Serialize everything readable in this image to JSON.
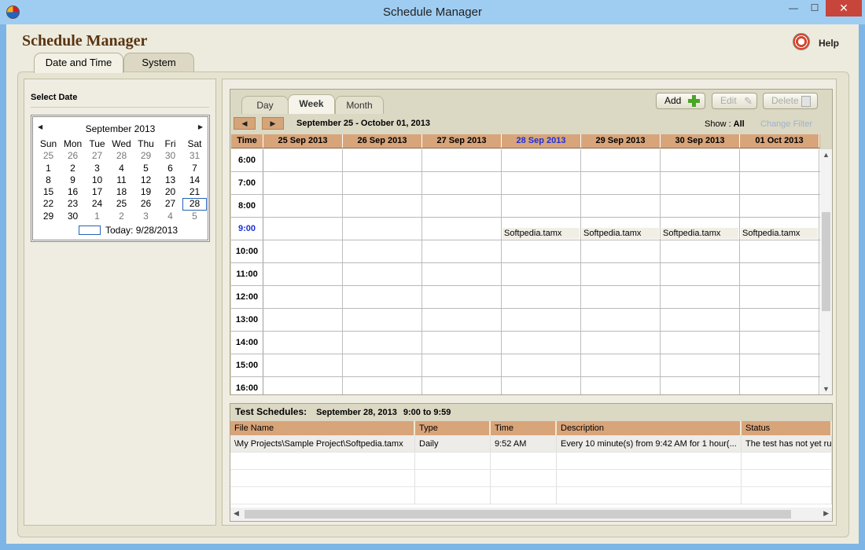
{
  "window": {
    "title": "Schedule Manager",
    "minimize": "—",
    "maximize": "☐",
    "close": "✕"
  },
  "app": {
    "heading": "Schedule Manager",
    "help_label": "Help"
  },
  "main_tabs": [
    {
      "label": "Date and Time"
    },
    {
      "label": "System"
    }
  ],
  "select_date": {
    "label": "Select Date",
    "calendar": {
      "month": "September 2013",
      "weekdays": [
        "Sun",
        "Mon",
        "Tue",
        "Wed",
        "Thu",
        "Fri",
        "Sat"
      ],
      "weeks": [
        [
          "25",
          "26",
          "27",
          "28",
          "29",
          "30",
          "31"
        ],
        [
          "1",
          "2",
          "3",
          "4",
          "5",
          "6",
          "7"
        ],
        [
          "8",
          "9",
          "10",
          "11",
          "12",
          "13",
          "14"
        ],
        [
          "15",
          "16",
          "17",
          "18",
          "19",
          "20",
          "21"
        ],
        [
          "22",
          "23",
          "24",
          "25",
          "26",
          "27",
          "28"
        ],
        [
          "29",
          "30",
          "1",
          "2",
          "3",
          "4",
          "5"
        ]
      ],
      "today_label": "Today: 9/28/2013"
    }
  },
  "schedule_view": {
    "tabs": [
      {
        "label": "Day"
      },
      {
        "label": "Week"
      },
      {
        "label": "Month"
      }
    ],
    "buttons": {
      "add": "Add",
      "edit": "Edit",
      "delete": "Delete"
    },
    "date_range": "September 25 - October 01, 2013",
    "show_label": "Show :",
    "show_value": "All",
    "change_filter": "Change Filter",
    "time_header": "Time",
    "days": [
      "25 Sep 2013",
      "26 Sep 2013",
      "27 Sep 2013",
      "28 Sep 2013",
      "29 Sep 2013",
      "30 Sep 2013",
      "01 Oct 2013"
    ],
    "highlight_day_index": 3,
    "times": [
      "6:00",
      "7:00",
      "8:00",
      "9:00",
      "10:00",
      "11:00",
      "12:00",
      "13:00",
      "14:00",
      "15:00",
      "16:00"
    ],
    "current_time_index": 3,
    "appointments": {
      "time_index": 3,
      "day_indices": [
        3,
        4,
        5,
        6
      ],
      "label": "Softpedia.tamx"
    }
  },
  "test_schedules": {
    "title": "Test Schedules:",
    "date": "September 28, 2013",
    "range": "9:00 to 9:59",
    "columns": [
      "File Name",
      "Type",
      "Time",
      "Description",
      "Status"
    ],
    "rows": [
      [
        "\\My Projects\\Sample Project\\Softpedia.tamx",
        "Daily",
        "9:52 AM",
        "Every 10 minute(s) from 9:42 AM for 1 hour(...",
        "The test has not yet run"
      ]
    ]
  }
}
